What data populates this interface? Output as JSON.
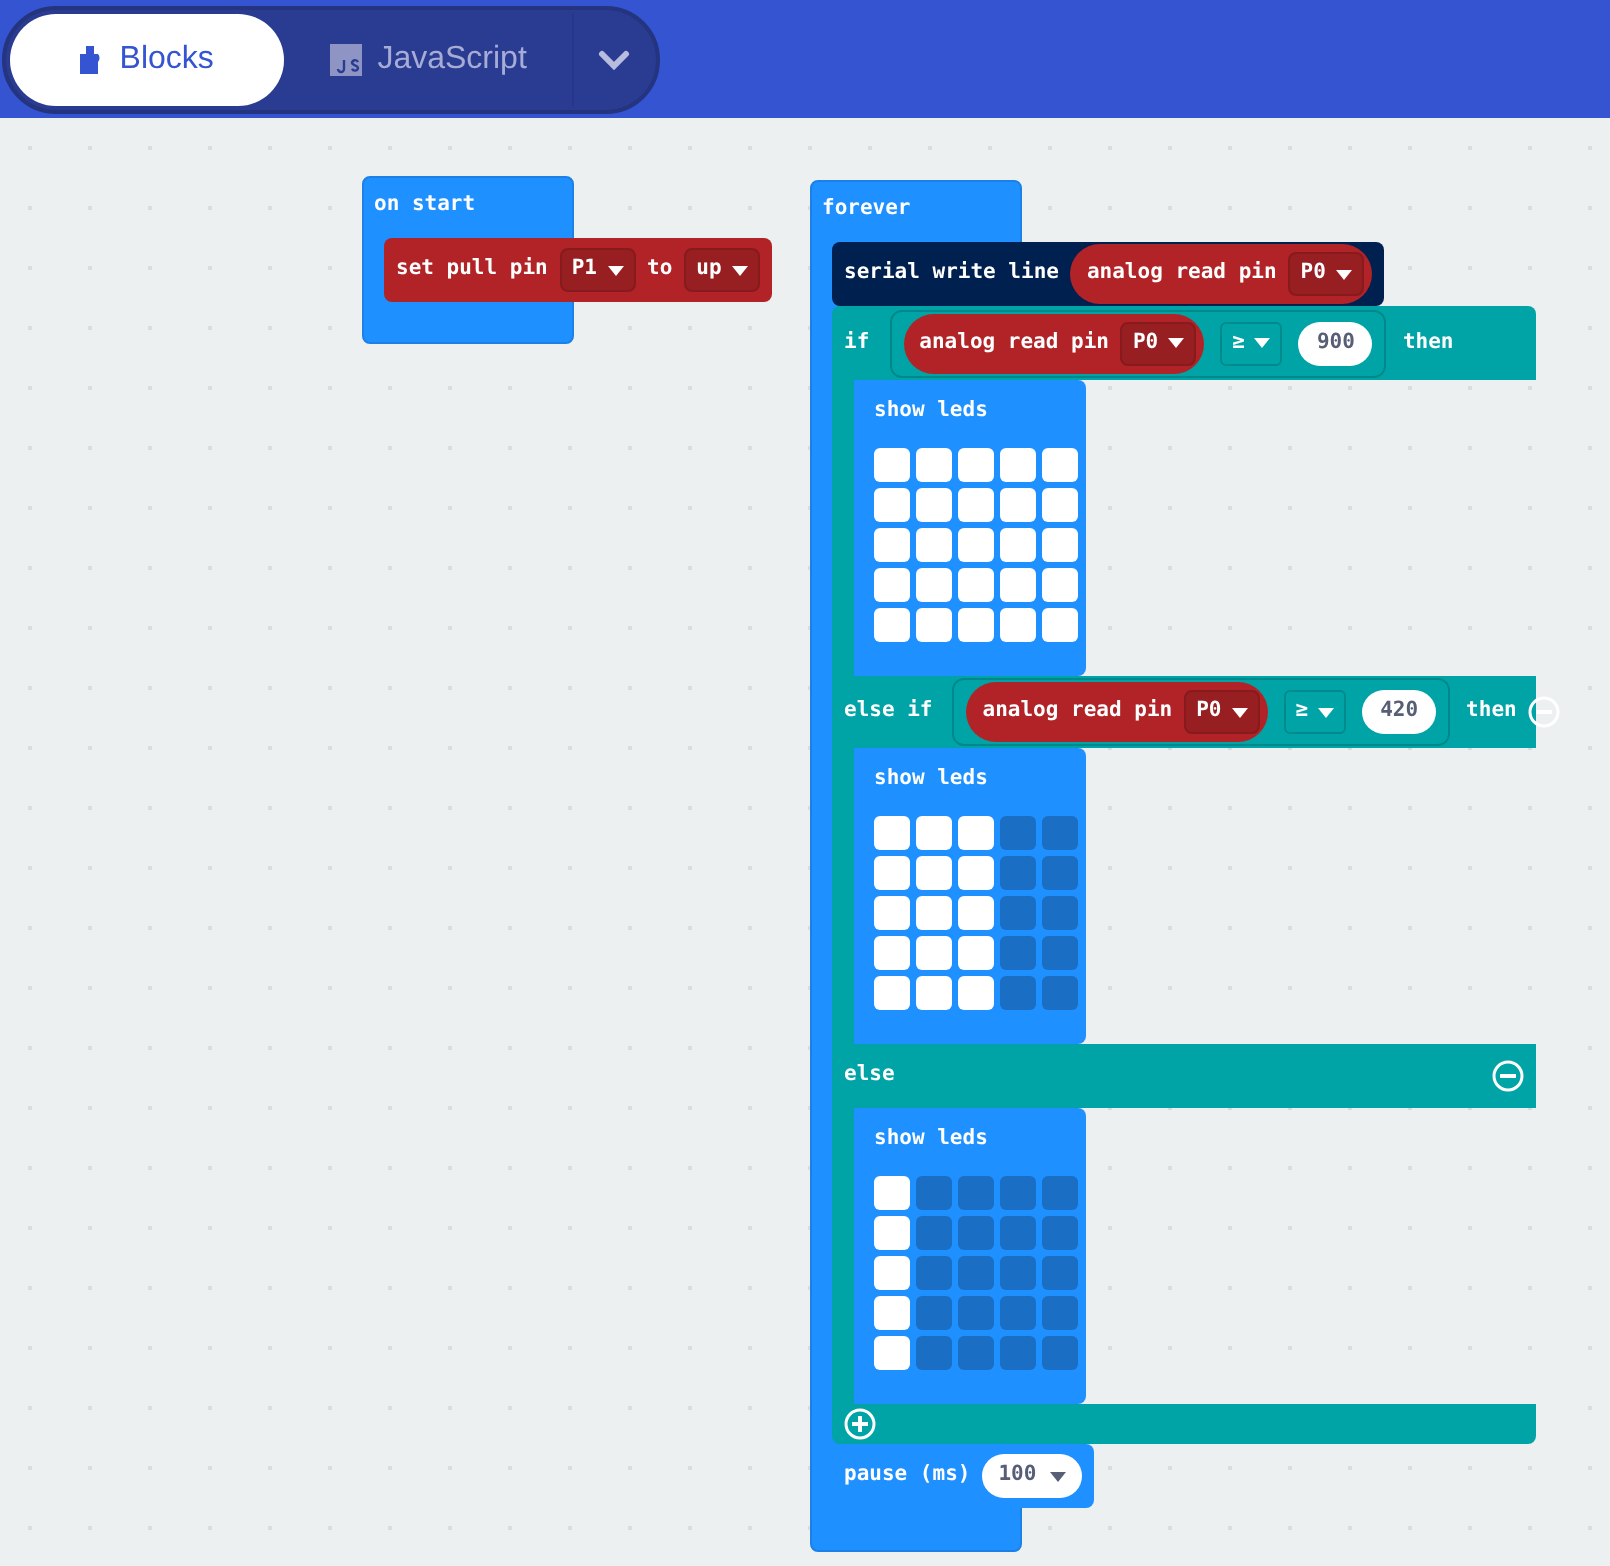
{
  "tabs": [
    {
      "label": "Blocks",
      "selected": true
    },
    {
      "label": "JavaScript",
      "selected": false
    }
  ],
  "on_start": {
    "label": "on start",
    "blocks": [
      {
        "kind": "statement",
        "color": "#b22327",
        "parts": [
          {
            "kind": "text",
            "text": "set pull pin"
          },
          {
            "kind": "dropdown",
            "text": "P1"
          },
          {
            "kind": "text",
            "text": "to"
          },
          {
            "kind": "dropdown",
            "text": "up"
          }
        ]
      }
    ]
  },
  "forever": {
    "label": "forever",
    "blocks": [
      {
        "kind": "statement",
        "color": "#002050",
        "parts": [
          {
            "kind": "text",
            "text": "serial write line"
          },
          {
            "kind": "reporter",
            "color": "#b22327",
            "parts": [
              {
                "kind": "text",
                "text": "analog read pin"
              },
              {
                "kind": "dropdown",
                "text": "P0"
              }
            ]
          }
        ]
      },
      {
        "kind": "if",
        "addable": true,
        "branches": [
          {
            "keyword": "if",
            "removable": false,
            "then": "then",
            "condition": [
              {
                "kind": "reporter",
                "color": "#b22327",
                "parts": [
                  {
                    "kind": "text",
                    "text": "analog read pin"
                  },
                  {
                    "kind": "dropdown",
                    "text": "P0"
                  }
                ]
              },
              {
                "kind": "op_dropdown",
                "text": "≥"
              },
              {
                "kind": "number",
                "text": "900"
              }
            ],
            "body": {
              "label": "show leds",
              "leds": [
                [
                  true,
                  true,
                  true,
                  true,
                  true
                ],
                [
                  true,
                  true,
                  true,
                  true,
                  true
                ],
                [
                  true,
                  true,
                  true,
                  true,
                  true
                ],
                [
                  true,
                  true,
                  true,
                  true,
                  true
                ],
                [
                  true,
                  true,
                  true,
                  true,
                  true
                ]
              ]
            }
          },
          {
            "keyword": "else if",
            "removable": true,
            "then": "then",
            "condition": [
              {
                "kind": "reporter",
                "color": "#b22327",
                "parts": [
                  {
                    "kind": "text",
                    "text": "analog read pin"
                  },
                  {
                    "kind": "dropdown",
                    "text": "P0"
                  }
                ]
              },
              {
                "kind": "op_dropdown",
                "text": "≥"
              },
              {
                "kind": "number",
                "text": "420"
              }
            ],
            "body": {
              "label": "show leds",
              "leds": [
                [
                  true,
                  true,
                  true,
                  false,
                  false
                ],
                [
                  true,
                  true,
                  true,
                  false,
                  false
                ],
                [
                  true,
                  true,
                  true,
                  false,
                  false
                ],
                [
                  true,
                  true,
                  true,
                  false,
                  false
                ],
                [
                  true,
                  true,
                  true,
                  false,
                  false
                ]
              ]
            }
          },
          {
            "keyword": "else",
            "removable": true,
            "body": {
              "label": "show leds",
              "leds": [
                [
                  true,
                  false,
                  false,
                  false,
                  false
                ],
                [
                  true,
                  false,
                  false,
                  false,
                  false
                ],
                [
                  true,
                  false,
                  false,
                  false,
                  false
                ],
                [
                  true,
                  false,
                  false,
                  false,
                  false
                ],
                [
                  true,
                  false,
                  false,
                  false,
                  false
                ]
              ]
            }
          }
        ]
      },
      {
        "kind": "statement",
        "color": "#1e90ff",
        "parts": [
          {
            "kind": "text",
            "text": "pause (ms)"
          },
          {
            "kind": "number_dropdown",
            "text": "100"
          }
        ]
      }
    ]
  }
}
